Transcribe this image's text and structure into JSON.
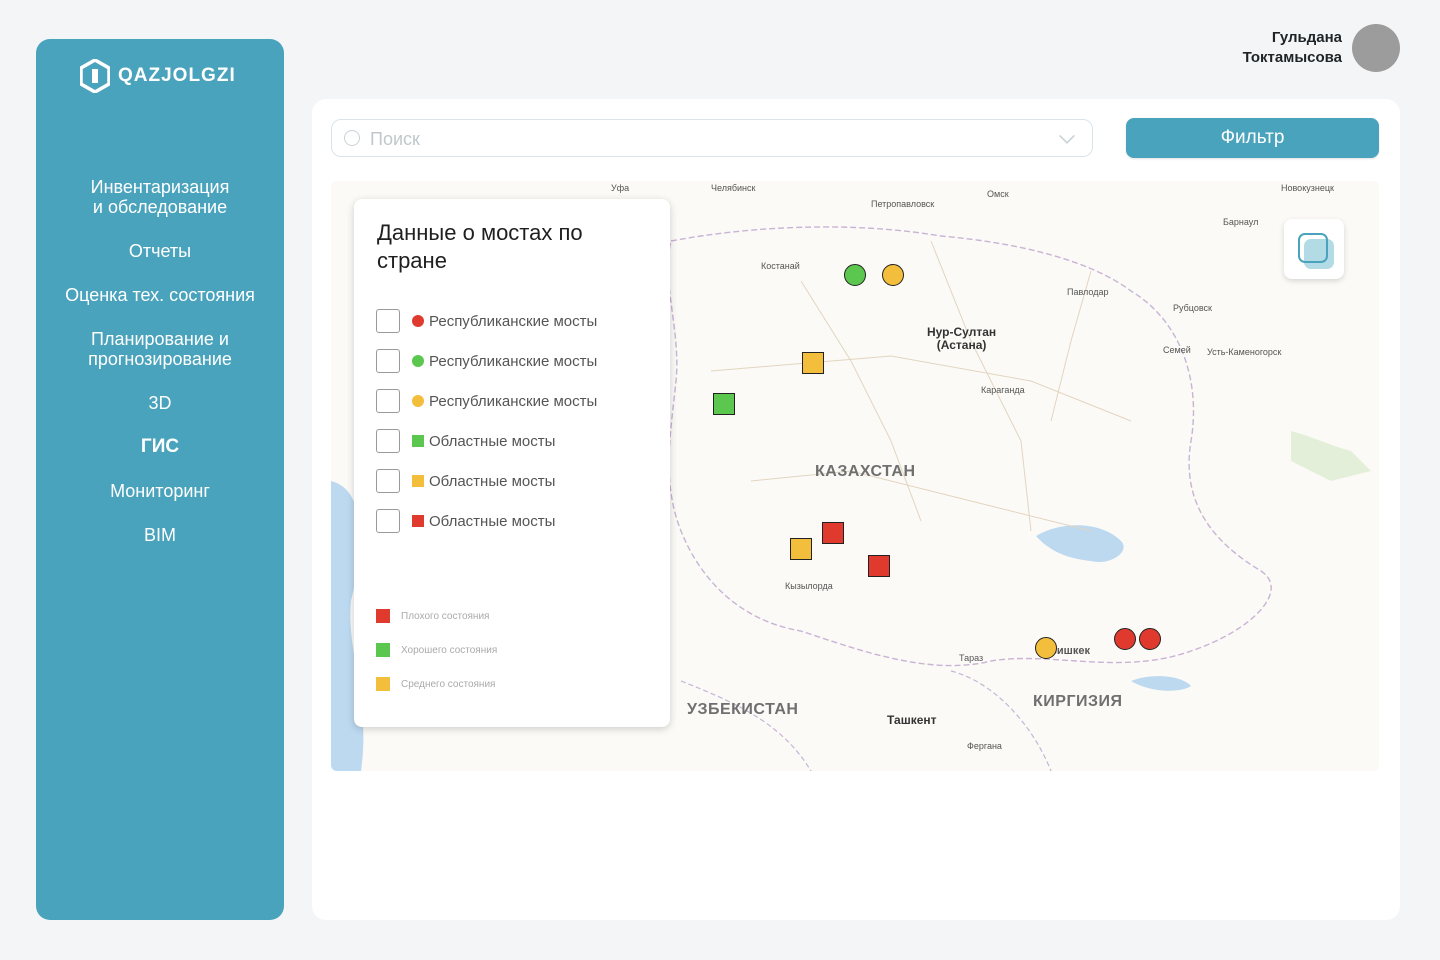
{
  "brand": {
    "name": "QAZJOLGZI"
  },
  "nav": {
    "items": [
      {
        "label": "Инвентаризация\nи обследование"
      },
      {
        "label": "Отчеты"
      },
      {
        "label": "Оценка тех. состояния"
      },
      {
        "label": "Планирование и\nпрогнозирование"
      },
      {
        "label": "3D"
      },
      {
        "label": "ГИС",
        "active": true
      },
      {
        "label": "Мониторинг"
      },
      {
        "label": "BIM"
      }
    ]
  },
  "user": {
    "first_name": "Гульдана",
    "last_name": "Токтамысова"
  },
  "search": {
    "placeholder": "Поиск",
    "value": ""
  },
  "filter": {
    "label": "Фильтр"
  },
  "colors": {
    "accent": "#4aa3bc",
    "bad": "#e03a2f",
    "good": "#5cc74e",
    "medium": "#f2be3c"
  },
  "panel": {
    "title": "Данные о мостах по стране",
    "layers": [
      {
        "label": "Республиканские мосты",
        "shape": "circle",
        "color": "#e03a2f",
        "checked": false
      },
      {
        "label": "Республиканские мосты",
        "shape": "circle",
        "color": "#5cc74e",
        "checked": false
      },
      {
        "label": "Республиканские мосты",
        "shape": "circle",
        "color": "#f2be3c",
        "checked": false
      },
      {
        "label": "Областные мосты",
        "shape": "square",
        "color": "#5cc74e",
        "checked": false
      },
      {
        "label": "Областные мосты",
        "shape": "square",
        "color": "#f2be3c",
        "checked": false
      },
      {
        "label": "Областные мосты",
        "shape": "square",
        "color": "#e03a2f",
        "checked": false
      }
    ],
    "conditions": [
      {
        "label": "Плохого состояния",
        "color": "#e03a2f"
      },
      {
        "label": "Хорошего состояния",
        "color": "#5cc74e"
      },
      {
        "label": "Среднего состояния",
        "color": "#f2be3c"
      }
    ]
  },
  "map": {
    "cities": [
      {
        "name": "Челябинск"
      },
      {
        "name": "Уфа"
      },
      {
        "name": "Петропавловск"
      },
      {
        "name": "Омск"
      },
      {
        "name": "Новокузнецк"
      },
      {
        "name": "Барнаул"
      },
      {
        "name": "Костанай"
      },
      {
        "name": "Павлодар"
      },
      {
        "name": "Рубцовск"
      },
      {
        "name": "Семей"
      },
      {
        "name": "Усть-Каменогорск"
      },
      {
        "name": "Караганда"
      },
      {
        "name": "Кызылорда"
      },
      {
        "name": "Тараз"
      },
      {
        "name": "Бишкек"
      },
      {
        "name": "Ташкент"
      },
      {
        "name": "Фергана"
      }
    ],
    "capital": "Нур-Султан\n(Астана)",
    "countries": [
      {
        "name": "КАЗАХСТАН"
      },
      {
        "name": "УЗБЕКИСТАН"
      },
      {
        "name": "КИРГИЗИЯ"
      }
    ],
    "markers": [
      {
        "type": "circle",
        "condition": "good"
      },
      {
        "type": "circle",
        "condition": "medium"
      },
      {
        "type": "square",
        "condition": "medium"
      },
      {
        "type": "square",
        "condition": "good"
      },
      {
        "type": "square",
        "condition": "bad"
      },
      {
        "type": "square",
        "condition": "medium"
      },
      {
        "type": "square",
        "condition": "bad"
      },
      {
        "type": "circle",
        "condition": "medium"
      },
      {
        "type": "circle",
        "condition": "bad"
      },
      {
        "type": "circle",
        "condition": "bad"
      }
    ]
  }
}
